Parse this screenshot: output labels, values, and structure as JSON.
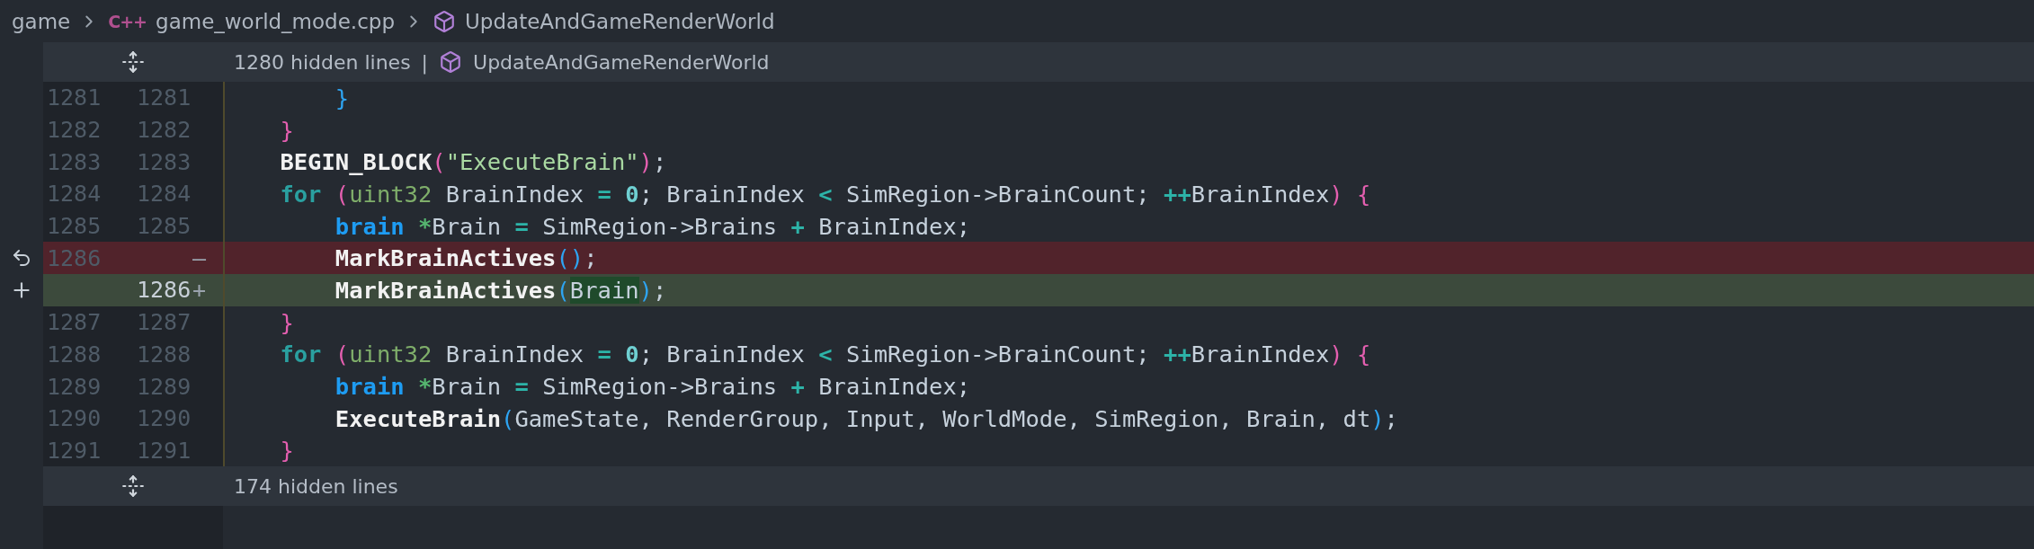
{
  "breadcrumb": [
    {
      "kind": "folder",
      "label": "game"
    },
    {
      "kind": "file",
      "icon_text": "C++",
      "label": "game_world_mode.cpp"
    },
    {
      "kind": "symbol",
      "label": "UpdateAndGameRenderWorld"
    }
  ],
  "diff": [
    {
      "kind": "hidden",
      "label": "1280 hidden lines",
      "separator": "|",
      "symbol": "UpdateAndGameRenderWorld"
    },
    {
      "kind": "context",
      "old": "1281",
      "new": "1281",
      "tokens": [
        {
          "kind": "paren2",
          "s": "        }"
        }
      ]
    },
    {
      "kind": "context",
      "old": "1282",
      "new": "1282",
      "tokens": [
        {
          "kind": "paren1",
          "s": "    }"
        }
      ]
    },
    {
      "kind": "context",
      "old": "1283",
      "new": "1283",
      "tokens": [
        {
          "kind": "func",
          "s": "    BEGIN_BLOCK"
        },
        {
          "kind": "paren1",
          "s": "("
        },
        {
          "kind": "string",
          "s": "\"ExecuteBrain\""
        },
        {
          "kind": "paren1",
          "s": ")"
        },
        {
          "kind": "plain",
          "s": ";"
        }
      ]
    },
    {
      "kind": "context",
      "old": "1284",
      "new": "1284",
      "tokens": [
        {
          "kind": "keyword",
          "s": "    for"
        },
        {
          "kind": "paren1",
          "s": " ("
        },
        {
          "kind": "type",
          "s": "uint32"
        },
        {
          "kind": "plain",
          "s": " BrainIndex "
        },
        {
          "kind": "op",
          "s": "="
        },
        {
          "kind": "number",
          "s": " 0"
        },
        {
          "kind": "plain",
          "s": "; BrainIndex "
        },
        {
          "kind": "op",
          "s": "<"
        },
        {
          "kind": "plain",
          "s": " SimRegion->BrainCount; "
        },
        {
          "kind": "op",
          "s": "++"
        },
        {
          "kind": "plain",
          "s": "BrainIndex"
        },
        {
          "kind": "paren1",
          "s": ") {"
        }
      ]
    },
    {
      "kind": "context",
      "old": "1285",
      "new": "1285",
      "tokens": [
        {
          "kind": "ptype",
          "s": "        brain"
        },
        {
          "kind": "star",
          "s": " *"
        },
        {
          "kind": "plain",
          "s": "Brain "
        },
        {
          "kind": "op",
          "s": "="
        },
        {
          "kind": "plain",
          "s": " SimRegion->Brains "
        },
        {
          "kind": "op",
          "s": "+"
        },
        {
          "kind": "plain",
          "s": " BrainIndex;"
        }
      ]
    },
    {
      "kind": "removed",
      "old": "1286",
      "marker": "—",
      "tokens": [
        {
          "kind": "func",
          "s": "        MarkBrainActives"
        },
        {
          "kind": "paren2",
          "s": "("
        },
        {
          "kind": "paren2",
          "s": ")"
        },
        {
          "kind": "plain",
          "s": ";"
        }
      ]
    },
    {
      "kind": "added",
      "new": "1286",
      "marker": "+",
      "tokens": [
        {
          "kind": "func",
          "s": "        MarkBrainActives"
        },
        {
          "kind": "paren2",
          "s": "("
        },
        {
          "kind": "inserted",
          "s": "Brain"
        },
        {
          "kind": "paren2",
          "s": ")"
        },
        {
          "kind": "plain",
          "s": ";"
        }
      ]
    },
    {
      "kind": "context",
      "old": "1287",
      "new": "1287",
      "tokens": [
        {
          "kind": "paren1",
          "s": "    }"
        }
      ]
    },
    {
      "kind": "context",
      "old": "1288",
      "new": "1288",
      "tokens": [
        {
          "kind": "keyword",
          "s": "    for"
        },
        {
          "kind": "paren1",
          "s": " ("
        },
        {
          "kind": "type",
          "s": "uint32"
        },
        {
          "kind": "plain",
          "s": " BrainIndex "
        },
        {
          "kind": "op",
          "s": "="
        },
        {
          "kind": "number",
          "s": " 0"
        },
        {
          "kind": "plain",
          "s": "; BrainIndex "
        },
        {
          "kind": "op",
          "s": "<"
        },
        {
          "kind": "plain",
          "s": " SimRegion->BrainCount; "
        },
        {
          "kind": "op",
          "s": "++"
        },
        {
          "kind": "plain",
          "s": "BrainIndex"
        },
        {
          "kind": "paren1",
          "s": ") {"
        }
      ]
    },
    {
      "kind": "context",
      "old": "1289",
      "new": "1289",
      "tokens": [
        {
          "kind": "ptype",
          "s": "        brain"
        },
        {
          "kind": "star",
          "s": " *"
        },
        {
          "kind": "plain",
          "s": "Brain "
        },
        {
          "kind": "op",
          "s": "="
        },
        {
          "kind": "plain",
          "s": " SimRegion->Brains "
        },
        {
          "kind": "op",
          "s": "+"
        },
        {
          "kind": "plain",
          "s": " BrainIndex;"
        }
      ]
    },
    {
      "kind": "context",
      "old": "1290",
      "new": "1290",
      "tokens": [
        {
          "kind": "func",
          "s": "        ExecuteBrain"
        },
        {
          "kind": "paren2",
          "s": "("
        },
        {
          "kind": "plain",
          "s": "GameState, RenderGroup, Input, WorldMode, SimRegion, Brain, dt"
        },
        {
          "kind": "paren2",
          "s": ")"
        },
        {
          "kind": "plain",
          "s": ";"
        }
      ]
    },
    {
      "kind": "context",
      "old": "1291",
      "new": "1291",
      "tokens": [
        {
          "kind": "paren1",
          "s": "    }"
        }
      ]
    },
    {
      "kind": "hidden",
      "label": "174 hidden lines"
    }
  ]
}
